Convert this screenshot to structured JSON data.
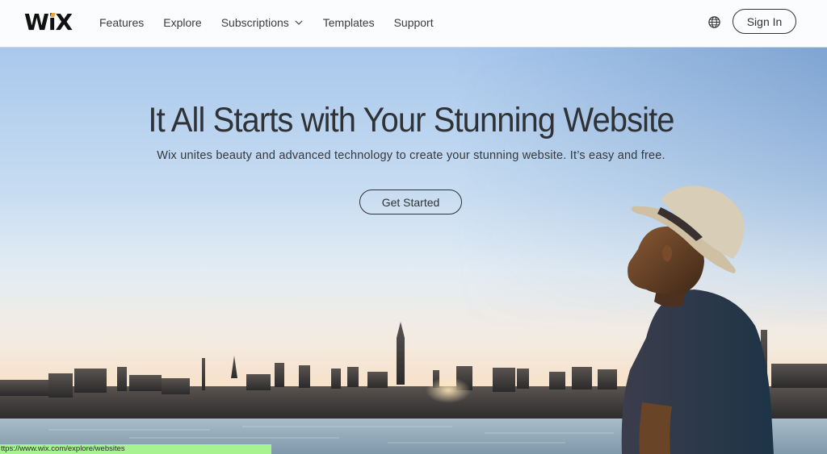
{
  "header": {
    "logo": {
      "prefix": "W",
      "i": "i",
      "suffix": "X",
      "accent_color": "#f3a13a"
    },
    "nav": [
      {
        "label": "Features",
        "has_dropdown": false
      },
      {
        "label": "Explore",
        "has_dropdown": false
      },
      {
        "label": "Subscriptions",
        "has_dropdown": true
      },
      {
        "label": "Templates",
        "has_dropdown": false
      },
      {
        "label": "Support",
        "has_dropdown": false
      }
    ],
    "language_icon": "globe-icon",
    "sign_in_label": "Sign In"
  },
  "hero": {
    "headline": "It All Starts with Your Stunning Website",
    "subheadline": "Wix unites beauty and advanced technology to create your stunning website. It’s easy and free.",
    "cta_label": "Get Started",
    "background": {
      "description": "City skyline at sunset across the water with a man in a straw hat in profile",
      "sky_top_color": "#8fb2dc",
      "sky_horizon_color": "#f4e4d2",
      "water_color": "#8fa6b5"
    }
  },
  "status_bar": {
    "url": "ttps://www.wix.com/explore/websites",
    "color": "#a6f38f"
  }
}
